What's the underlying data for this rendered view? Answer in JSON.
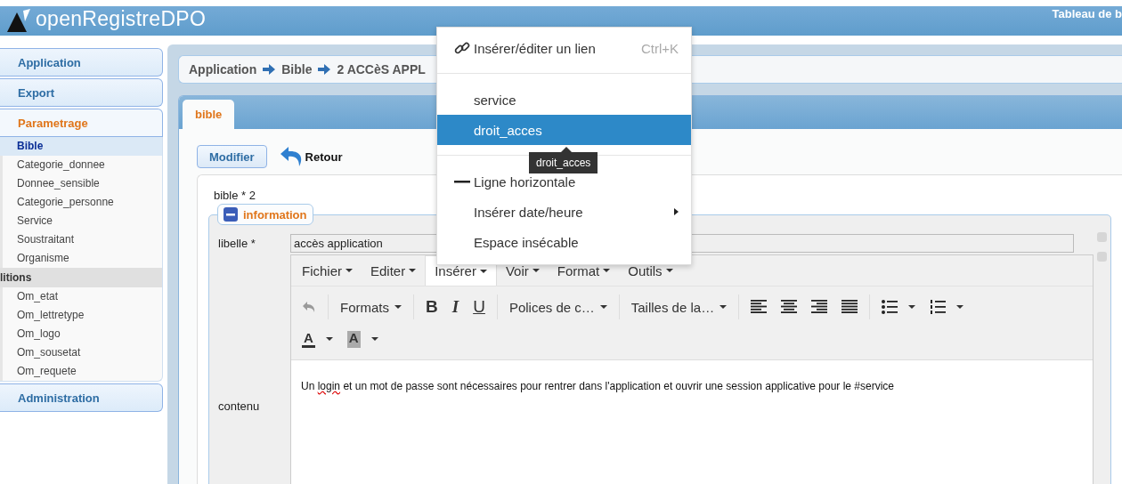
{
  "header": {
    "logo_text": "openRegistreDPO",
    "right_link": "Tableau de b"
  },
  "sidebar": {
    "sections": [
      {
        "label": "Application",
        "open": false
      },
      {
        "label": "Export",
        "open": false
      },
      {
        "label": "Parametrage",
        "open": true,
        "groups": [
          {
            "items": [
              {
                "label": "Bible",
                "selected": true
              },
              {
                "label": "Categorie_donnee",
                "selected": false
              },
              {
                "label": "Donnee_sensible",
                "selected": false
              },
              {
                "label": "Categorie_personne",
                "selected": false
              },
              {
                "label": "Service",
                "selected": false
              },
              {
                "label": "Soustraitant",
                "selected": false
              },
              {
                "label": "Organisme",
                "selected": false
              }
            ]
          },
          {
            "title": "litions",
            "items": [
              {
                "label": "Om_etat",
                "selected": false
              },
              {
                "label": "Om_lettretype",
                "selected": false
              },
              {
                "label": "Om_logo",
                "selected": false
              },
              {
                "label": "Om_sousetat",
                "selected": false
              },
              {
                "label": "Om_requete",
                "selected": false
              }
            ]
          }
        ]
      },
      {
        "label": "Administration",
        "open": false
      }
    ]
  },
  "breadcrumb": [
    "Application",
    "Bible",
    "2 ACCèS APPL"
  ],
  "tabs": [
    {
      "label": "bible",
      "selected": true
    }
  ],
  "actions": {
    "edit_button": "Modifier",
    "back_link": "Retour"
  },
  "record_title": "bible * 2",
  "fieldset": {
    "legend": "information",
    "collapsed": false,
    "libelle": {
      "label": "libelle *",
      "value": "accès application"
    },
    "contenu": {
      "label": "contenu"
    }
  },
  "editor": {
    "menubar": [
      {
        "label": "Fichier",
        "selected": false
      },
      {
        "label": "Editer",
        "selected": false
      },
      {
        "label": "Insérer",
        "selected": true
      },
      {
        "label": "Voir",
        "selected": false
      },
      {
        "label": "Format",
        "selected": false
      },
      {
        "label": "Outils",
        "selected": false
      }
    ],
    "toolbar_rows": [
      [
        {
          "kind": "undo",
          "disabled": true
        },
        {
          "kind": "separator"
        },
        {
          "kind": "dropdown",
          "label": "Formats"
        },
        {
          "kind": "separator"
        },
        {
          "kind": "bold",
          "glyph": "B"
        },
        {
          "kind": "italic",
          "glyph": "I"
        },
        {
          "kind": "underline",
          "glyph": "U"
        },
        {
          "kind": "separator"
        },
        {
          "kind": "dropdown",
          "label": "Polices de c…"
        },
        {
          "kind": "separator"
        },
        {
          "kind": "dropdown",
          "label": "Tailles de la…"
        },
        {
          "kind": "separator"
        },
        {
          "kind": "align-left"
        },
        {
          "kind": "align-center"
        },
        {
          "kind": "align-right"
        },
        {
          "kind": "justify"
        },
        {
          "kind": "separator"
        },
        {
          "kind": "bullet-list"
        },
        {
          "kind": "numbered-list"
        }
      ],
      [
        {
          "kind": "text-color",
          "glyph": "A"
        },
        {
          "kind": "background-color",
          "glyph": "A"
        }
      ]
    ],
    "content": [
      {
        "text": "Un "
      },
      {
        "text": "login",
        "misspelled": true
      },
      {
        "text": " et un mot de passe sont nécessaires pour rentrer dans l'application et ouvrir une session applicative pour le #service"
      }
    ]
  },
  "insert_menu": [
    {
      "kind": "link",
      "label": "Insérer/éditer un lien",
      "shortcut": "Ctrl+K"
    },
    {
      "kind": "separator"
    },
    {
      "kind": "item",
      "label": "service",
      "selected": false
    },
    {
      "kind": "item",
      "label": "droit_acces",
      "selected": true,
      "tooltip": "droit_acces"
    },
    {
      "kind": "separator"
    },
    {
      "kind": "hr",
      "label": "Ligne horizontale"
    },
    {
      "kind": "submenu",
      "label": "Insérer date/heure"
    },
    {
      "kind": "item",
      "label": "Espace insécable",
      "selected": false
    }
  ]
}
